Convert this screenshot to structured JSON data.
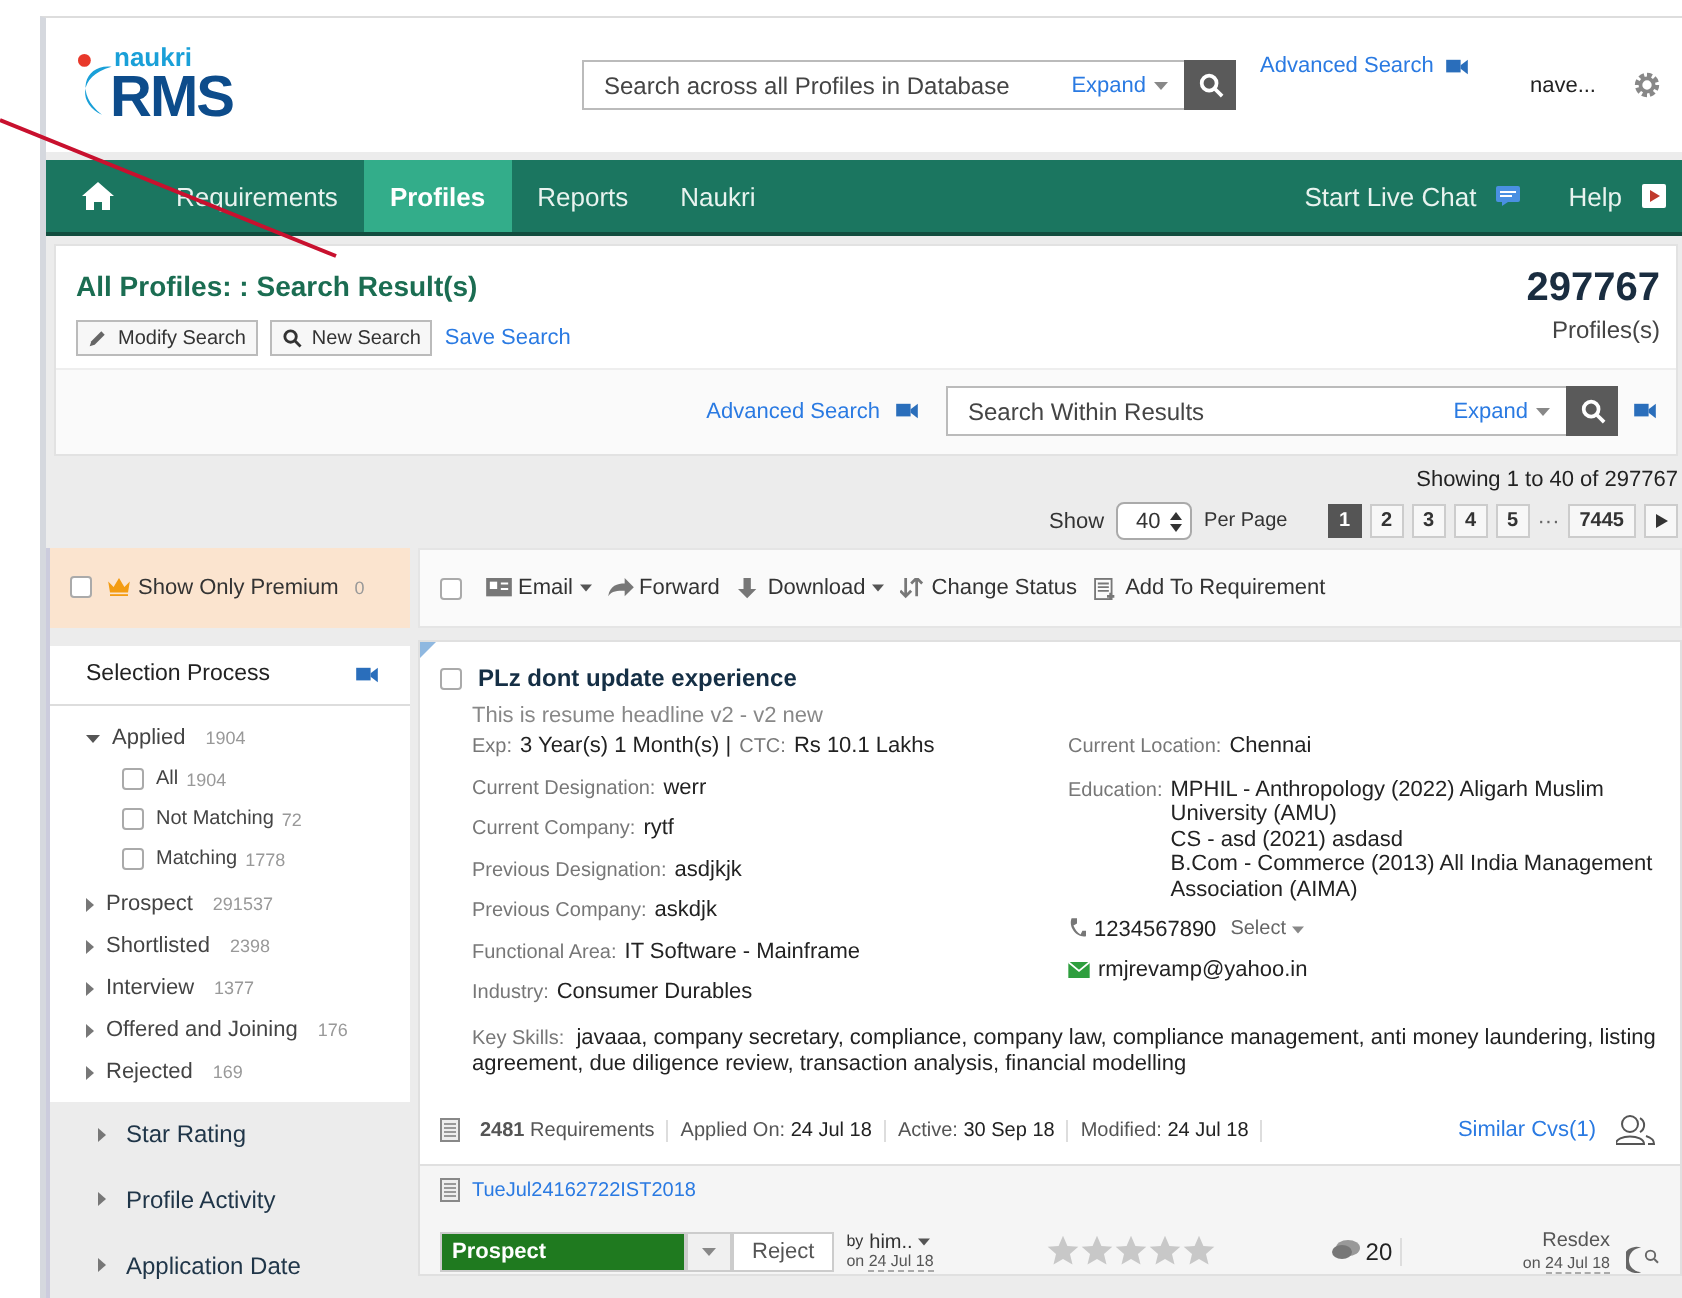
{
  "header": {
    "logo": {
      "top": "naukri",
      "main": "RMS"
    },
    "search": {
      "placeholder": "Search across all Profiles in Database",
      "expand": "Expand"
    },
    "advanced_search": "Advanced Search",
    "user": "nave..."
  },
  "nav": {
    "items": [
      {
        "label": "Requirements",
        "selected": false
      },
      {
        "label": "Profiles",
        "selected": true
      },
      {
        "label": "Reports",
        "selected": false
      },
      {
        "label": "Naukri",
        "selected": false
      }
    ],
    "live_chat": "Start Live Chat",
    "help": "Help"
  },
  "results": {
    "title": "All Profiles: : Search Result(s)",
    "buttons": [
      {
        "label": "Modify Search",
        "kind": "pencil"
      },
      {
        "label": "New Search",
        "kind": "search"
      }
    ],
    "save_search": "Save Search",
    "count": "297767",
    "count_label": "Profiles(s)"
  },
  "within": {
    "advanced_search": "Advanced Search",
    "placeholder": "Search Within Results",
    "expand": "Expand"
  },
  "paging": {
    "showing": "Showing 1 to 40 of 297767",
    "show": "Show",
    "per_page_value": "40",
    "per_page": "Per Page",
    "pages": [
      {
        "label": "1",
        "selected": true
      },
      {
        "label": "2",
        "selected": false
      },
      {
        "label": "3",
        "selected": false
      },
      {
        "label": "4",
        "selected": false
      },
      {
        "label": "5",
        "selected": false
      }
    ],
    "ellipsis": "···",
    "last": "7445"
  },
  "sidebar": {
    "premium": {
      "label": "Show Only Premium",
      "count": "0",
      "checked": false
    },
    "selection_process": {
      "title": "Selection Process",
      "groups": [
        {
          "label": "Applied",
          "count": "1904",
          "expanded": true,
          "children": [
            {
              "label": "All",
              "count": "1904",
              "checked": false
            },
            {
              "label": "Not Matching",
              "count": "72",
              "checked": false
            },
            {
              "label": "Matching",
              "count": "1778",
              "checked": false
            }
          ]
        },
        {
          "label": "Prospect",
          "count": "291537",
          "expanded": false
        },
        {
          "label": "Shortlisted",
          "count": "2398",
          "expanded": false
        },
        {
          "label": "Interview",
          "count": "1377",
          "expanded": false
        },
        {
          "label": "Offered and Joining",
          "count": "176",
          "expanded": false
        },
        {
          "label": "Rejected",
          "count": "169",
          "expanded": false
        }
      ]
    },
    "sections": [
      {
        "label": "Star Rating",
        "expanded": false
      },
      {
        "label": "Profile Activity",
        "expanded": false
      },
      {
        "label": "Application Date",
        "expanded": false
      }
    ]
  },
  "toolbar": {
    "select_all": false,
    "actions": [
      {
        "label": "Email",
        "kind": "email",
        "dropdown": true
      },
      {
        "label": "Forward",
        "kind": "forward",
        "dropdown": false
      },
      {
        "label": "Download",
        "kind": "download",
        "dropdown": true
      },
      {
        "label": "Change Status",
        "kind": "status",
        "dropdown": false
      },
      {
        "label": "Add To Requirement",
        "kind": "add",
        "dropdown": false
      }
    ]
  },
  "profile": {
    "checked": false,
    "title": "PLz dont update experience",
    "headline": "This is resume headline v2 - v2 new",
    "left": [
      {
        "pairs": [
          {
            "label": "Exp:",
            "value": "3 Year(s) 1 Month(s) |"
          },
          {
            "label": "CTC:",
            "value": "Rs 10.1 Lakhs"
          }
        ]
      },
      {
        "pairs": [
          {
            "label": "Current Designation:",
            "value": "werr"
          }
        ]
      },
      {
        "pairs": [
          {
            "label": "Current Company:",
            "value": "rytf"
          }
        ]
      },
      {
        "pairs": [
          {
            "label": "Previous Designation:",
            "value": "asdjkjk"
          }
        ]
      },
      {
        "pairs": [
          {
            "label": "Previous Company:",
            "value": "askdjk"
          }
        ]
      },
      {
        "pairs": [
          {
            "label": "Functional Area:",
            "value": "IT Software - Mainframe"
          }
        ]
      },
      {
        "pairs": [
          {
            "label": "Industry:",
            "value": "Consumer Durables"
          }
        ]
      }
    ],
    "location": {
      "label": "Current Location:",
      "value": "Chennai"
    },
    "education": {
      "label": "Education:",
      "lines": [
        "MPHIL - Anthropology (2022) Aligarh Muslim University (AMU)",
        "CS - asd (2021) asdasd",
        "B.Com - Commerce (2013) All India Management Association (AIMA)"
      ]
    },
    "phone": "1234567890",
    "phone_action": "Select",
    "email": "rmjrevamp@yahoo.in",
    "key_skills": {
      "label": "Key Skills:",
      "value": "javaaa, company secretary, compliance, company law, compliance management, anti money laundering, listing agreement, due diligence review, transaction analysis, financial modelling"
    },
    "requirements_count": "2481",
    "requirements_label": "Requirements",
    "meta": [
      {
        "label": "Applied On:",
        "value": "24 Jul 18"
      },
      {
        "label": "Active:",
        "value": "30 Sep 18"
      },
      {
        "label": "Modified:",
        "value": "24 Jul 18"
      }
    ],
    "similar": "Similar Cvs(1)"
  },
  "note": {
    "link": "TueJul24162722IST2018"
  },
  "status": {
    "stage": "Prospect",
    "reject": "Reject",
    "by_prefix": "by",
    "by": "him..",
    "on_label": "on",
    "date": "24 Jul 18",
    "stars": 0,
    "comments": "20",
    "source": "Resdex",
    "source_on": "on",
    "source_date": "24 Jul 18"
  }
}
